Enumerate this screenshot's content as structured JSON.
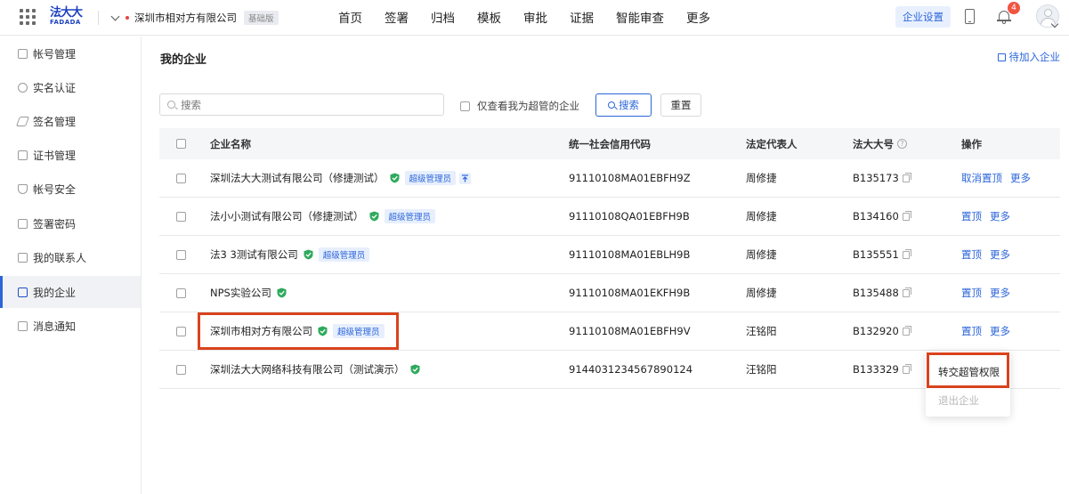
{
  "header": {
    "logo_cn": "法大大",
    "logo_en": "FADADA",
    "org_name": "深圳市相对方有限公司",
    "org_plan": "基础版",
    "nav": [
      "首页",
      "签署",
      "归档",
      "模板",
      "审批",
      "证据",
      "智能审查",
      "更多"
    ],
    "settings_label": "企业设置",
    "notification_count": "4",
    "icons": [
      "grid-icon",
      "phone-icon",
      "bell-icon",
      "avatar-icon"
    ]
  },
  "sidebar": {
    "items": [
      {
        "label": "帐号管理",
        "icon": "account-icon"
      },
      {
        "label": "实名认证",
        "icon": "verify-icon"
      },
      {
        "label": "签名管理",
        "icon": "pen-icon"
      },
      {
        "label": "证书管理",
        "icon": "certificate-icon"
      },
      {
        "label": "帐号安全",
        "icon": "shield-icon"
      },
      {
        "label": "签署密码",
        "icon": "lock-icon"
      },
      {
        "label": "我的联系人",
        "icon": "contact-icon"
      },
      {
        "label": "我的企业",
        "icon": "company-icon",
        "active": true
      },
      {
        "label": "消息通知",
        "icon": "message-icon"
      }
    ]
  },
  "main": {
    "title": "我的企业",
    "pending_label": "待加入企业",
    "search_placeholder": "搜索",
    "only_super_label": "仅查看我为超管的企业",
    "search_button": "搜索",
    "reset_button": "重置",
    "columns": [
      "企业名称",
      "统一社会信用代码",
      "法定代表人",
      "法大大号",
      "操作"
    ],
    "rows": [
      {
        "name": "深圳法大大测试有限公司（修捷测试）",
        "super": "超级管理员",
        "pinned": true,
        "code": "91110108MA01EBFH9Z",
        "rep": "周修捷",
        "num": "B135173",
        "ops": [
          "取消置顶",
          "更多"
        ]
      },
      {
        "name": "法小小测试有限公司（修捷测试）",
        "super": "超级管理员",
        "pinned": false,
        "code": "91110108QA01EBFH9B",
        "rep": "周修捷",
        "num": "B134160",
        "ops": [
          "置顶",
          "更多"
        ]
      },
      {
        "name": "法3 3测试有限公司",
        "super": "超级管理员",
        "pinned": false,
        "code": "91110108MA01EBLH9B",
        "rep": "周修捷",
        "num": "B135551",
        "ops": [
          "置顶",
          "更多"
        ]
      },
      {
        "name": "NPS实验公司",
        "super": "",
        "pinned": false,
        "code": "91110108MA01EKFH9B",
        "rep": "周修捷",
        "num": "B135488",
        "ops": [
          "置顶",
          "更多"
        ]
      },
      {
        "name": "深圳市相对方有限公司",
        "super": "超级管理员",
        "pinned": false,
        "code": "91110108MA01EBFH9V",
        "rep": "汪铭阳",
        "num": "B132920",
        "ops": [
          "置顶",
          "更多"
        ]
      },
      {
        "name": "深圳法大大网络科技有限公司（测试演示）",
        "super": "",
        "pinned": false,
        "code": "9144031234567890124",
        "rep": "汪铭阳",
        "num": "B133329",
        "ops": []
      }
    ],
    "dropdown": [
      "转交超管权限",
      "退出企业"
    ]
  },
  "colors": {
    "accent": "#2b65d9",
    "highlight": "#d9431e",
    "verified": "#2eaa5c"
  }
}
